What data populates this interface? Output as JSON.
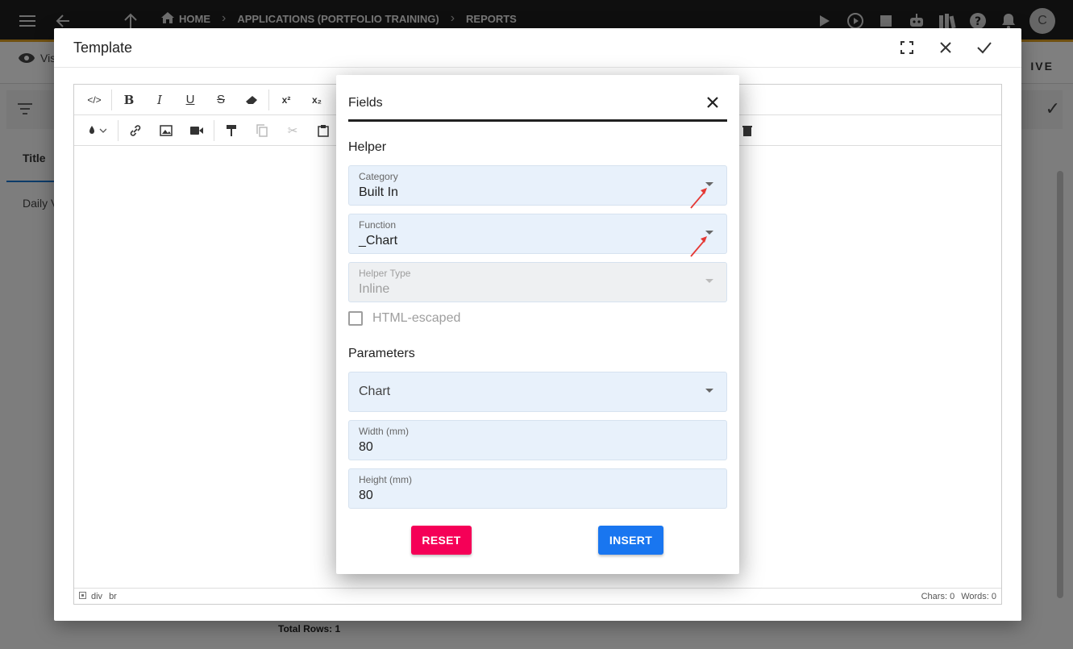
{
  "appbar": {
    "breadcrumbs": [
      "HOME",
      "APPLICATIONS (PORTFOLIO TRAINING)",
      "REPORTS"
    ],
    "avatar_initial": "C"
  },
  "page": {
    "visibility_label": "Vis",
    "logo_text": "IVE",
    "title_column": "Title",
    "row_value": "Daily V",
    "total_rows": "Total Rows: 1"
  },
  "template_dialog": {
    "title": "Template",
    "statusbar": {
      "path": [
        "div",
        "br"
      ],
      "chars": "Chars: 0",
      "words": "Words: 0"
    }
  },
  "fields_dialog": {
    "title": "Fields",
    "helper_section": "Helper",
    "category": {
      "label": "Category",
      "value": "Built In"
    },
    "function": {
      "label": "Function",
      "value": "_Chart"
    },
    "helper_type": {
      "label": "Helper Type",
      "value": "Inline"
    },
    "html_escaped_label": "HTML-escaped",
    "parameters_section": "Parameters",
    "chart_select": {
      "value": "Chart"
    },
    "width": {
      "label": "Width (mm)",
      "value": "80"
    },
    "height": {
      "label": "Height (mm)",
      "value": "80"
    },
    "reset_label": "RESET",
    "insert_label": "INSERT"
  },
  "colors": {
    "reset": "#f50057",
    "insert": "#1976f0",
    "field_bg": "#e8f1fb",
    "annotation_arrow": "#e53935"
  }
}
